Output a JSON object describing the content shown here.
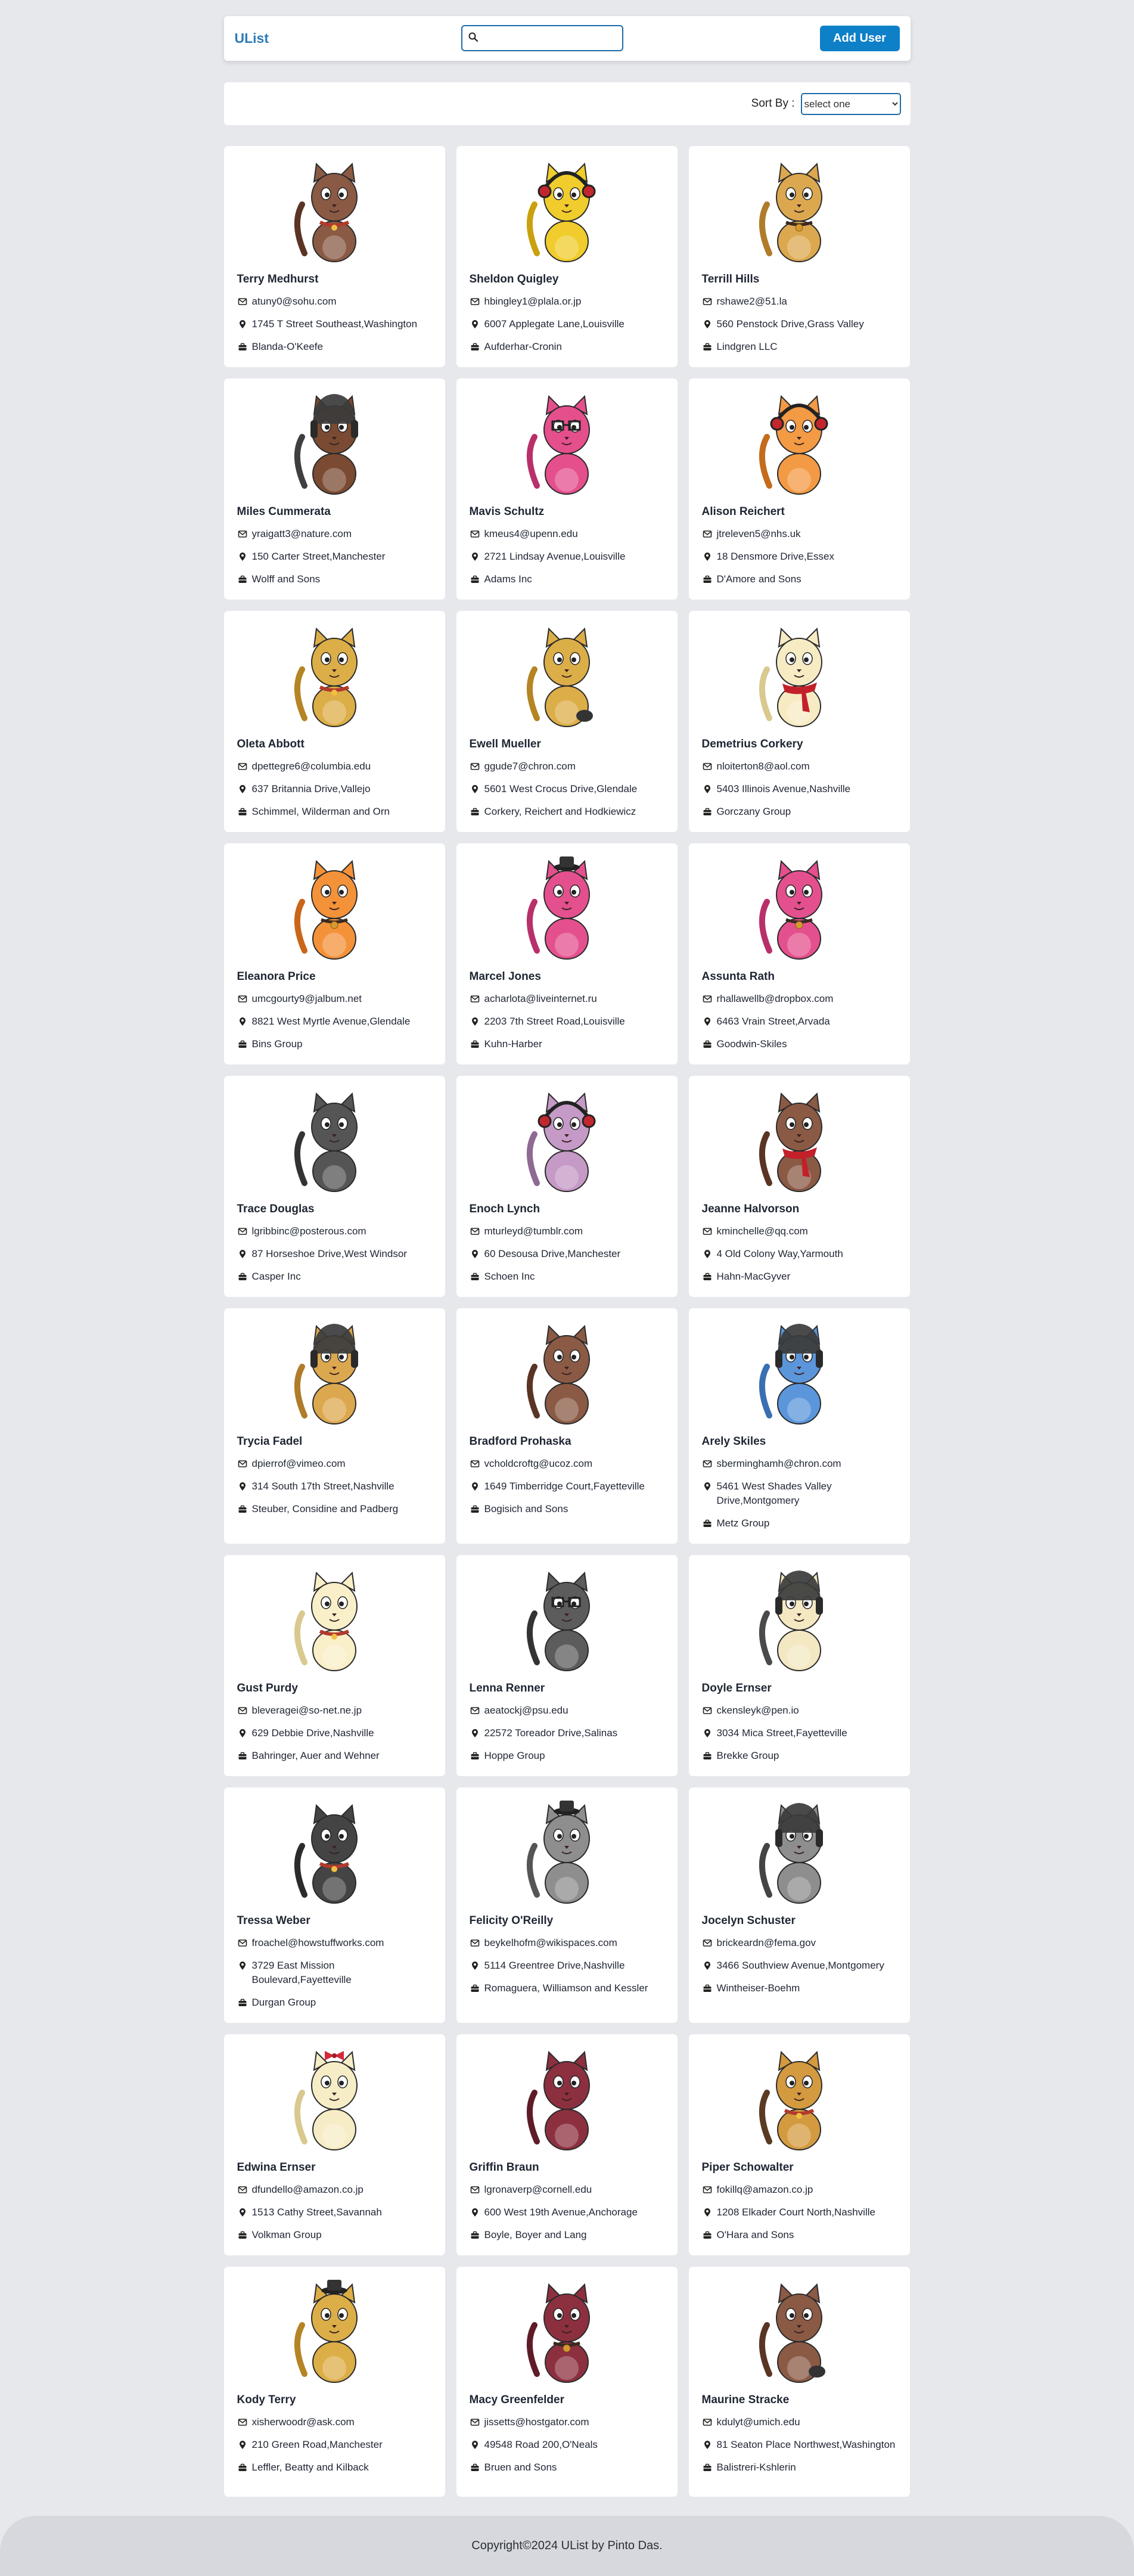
{
  "navbar": {
    "brand": "UList",
    "search_placeholder": "",
    "search_icon": "search-icon",
    "add_label": "Add User"
  },
  "sort": {
    "label": "Sort By :",
    "selected": "select one"
  },
  "users": [
    {
      "name": "Terry Medhurst",
      "email": "atuny0@sohu.com",
      "address": "1745 T Street Southeast,Washington",
      "company": "Blanda-O'Keefe",
      "body": "#8a5a45",
      "accent": "#5a3424",
      "acc": "collar"
    },
    {
      "name": "Sheldon Quigley",
      "email": "hbingley1@plala.or.jp",
      "address": "6007 Applegate Lane,Louisville",
      "company": "Aufderhar-Cronin",
      "body": "#f0cd2c",
      "accent": "#c9a10e",
      "acc": "headphones"
    },
    {
      "name": "Terrill Hills",
      "email": "rshawe2@51.la",
      "address": "560 Penstock Drive,Grass Valley",
      "company": "Lindgren LLC",
      "body": "#dca84f",
      "accent": "#b07c2a",
      "acc": "bell"
    },
    {
      "name": "Miles Cummerata",
      "email": "yraigatt3@nature.com",
      "address": "150 Carter Street,Manchester",
      "company": "Wolff and Sons",
      "body": "#7a4a32",
      "accent": "#3f3f3f",
      "acc": "helmet"
    },
    {
      "name": "Mavis Schultz",
      "email": "kmeus4@upenn.edu",
      "address": "2721 Lindsay Avenue,Louisville",
      "company": "Adams Inc",
      "body": "#e44f8c",
      "accent": "#b8306a",
      "acc": "glasses"
    },
    {
      "name": "Alison Reichert",
      "email": "jtreleven5@nhs.uk",
      "address": "18 Densmore Drive,Essex",
      "company": "D'Amore and Sons",
      "body": "#f39a44",
      "accent": "#c46b1c",
      "acc": "headphones"
    },
    {
      "name": "Oleta Abbott",
      "email": "dpettegre6@columbia.edu",
      "address": "637 Britannia Drive,Vallejo",
      "company": "Schimmel, Wilderman and Orn",
      "body": "#dcae48",
      "accent": "#b58424",
      "acc": "collar"
    },
    {
      "name": "Ewell Mueller",
      "email": "ggude7@chron.com",
      "address": "5601 West Crocus Drive,Glendale",
      "company": "Corkery, Reichert and Hodkiewicz",
      "body": "#dcae48",
      "accent": "#b58424",
      "acc": "paw"
    },
    {
      "name": "Demetrius Corkery",
      "email": "nloiterton8@aol.com",
      "address": "5403 Illinois Avenue,Nashville",
      "company": "Gorczany Group",
      "body": "#f7ebc4",
      "accent": "#d9c98f",
      "acc": "scarf"
    },
    {
      "name": "Eleanora Price",
      "email": "umcgourty9@jalbum.net",
      "address": "8821 West Myrtle Avenue,Glendale",
      "company": "Bins Group",
      "body": "#f4923a",
      "accent": "#c9661a",
      "acc": "bell"
    },
    {
      "name": "Marcel Jones",
      "email": "acharlota@liveinternet.ru",
      "address": "2203 7th Street Road,Louisville",
      "company": "Kuhn-Harber",
      "body": "#e4508d",
      "accent": "#b8306a",
      "acc": "hat"
    },
    {
      "name": "Assunta Rath",
      "email": "rhallawellb@dropbox.com",
      "address": "6463 Vrain Street,Arvada",
      "company": "Goodwin-Skiles",
      "body": "#e4508d",
      "accent": "#b8306a",
      "acc": "bell"
    },
    {
      "name": "Trace Douglas",
      "email": "lgribbinc@posterous.com",
      "address": "87 Horseshoe Drive,West Windsor",
      "company": "Casper Inc",
      "body": "#555555",
      "accent": "#333333",
      "acc": "none"
    },
    {
      "name": "Enoch Lynch",
      "email": "mturleyd@tumblr.com",
      "address": "60 Desousa Drive,Manchester",
      "company": "Schoen Inc",
      "body": "#c59ac6",
      "accent": "#8f6a92",
      "acc": "headphones"
    },
    {
      "name": "Jeanne Halvorson",
      "email": "kminchelle@qq.com",
      "address": "4 Old Colony Way,Yarmouth",
      "company": "Hahn-MacGyver",
      "body": "#8a5a45",
      "accent": "#5a3424",
      "acc": "scarf"
    },
    {
      "name": "Trycia Fadel",
      "email": "dpierrof@vimeo.com",
      "address": "314 South 17th Street,Nashville",
      "company": "Steuber, Considine and Padberg",
      "body": "#dca84f",
      "accent": "#b07c2a",
      "acc": "helmet"
    },
    {
      "name": "Bradford Prohaska",
      "email": "vcholdcroftg@ucoz.com",
      "address": "1649 Timberridge Court,Fayetteville",
      "company": "Bogisich and Sons",
      "body": "#8a5a45",
      "accent": "#5a3424",
      "acc": "none"
    },
    {
      "name": "Arely Skiles",
      "email": "sberminghamh@chron.com",
      "address": "5461 West Shades Valley Drive,Montgomery",
      "company": "Metz Group",
      "body": "#5b96db",
      "accent": "#3a6fb2",
      "acc": "helmet"
    },
    {
      "name": "Gust Purdy",
      "email": "bleveragei@so-net.ne.jp",
      "address": "629 Debbie Drive,Nashville",
      "company": "Bahringer, Auer and Wehner",
      "body": "#f9efc8",
      "accent": "#d9c98f",
      "acc": "collar"
    },
    {
      "name": "Lenna Renner",
      "email": "aeatockj@psu.edu",
      "address": "22572 Toreador Drive,Salinas",
      "company": "Hoppe Group",
      "body": "#5c5c5c",
      "accent": "#333333",
      "acc": "glasses"
    },
    {
      "name": "Doyle Ernser",
      "email": "ckensleyk@pen.io",
      "address": "3034 Mica Street,Fayetteville",
      "company": "Brekke Group",
      "body": "#f3e8c2",
      "accent": "#4a4a4a",
      "acc": "helmet"
    },
    {
      "name": "Tressa Weber",
      "email": "froachel@howstuffworks.com",
      "address": "3729 East Mission Boulevard,Fayetteville",
      "company": "Durgan Group",
      "body": "#444444",
      "accent": "#2b2b2b",
      "acc": "collar"
    },
    {
      "name": "Felicity O'Reilly",
      "email": "beykelhofm@wikispaces.com",
      "address": "5114 Greentree Drive,Nashville",
      "company": "Romaguera, Williamson and Kessler",
      "body": "#8e8e8e",
      "accent": "#555555",
      "acc": "hat"
    },
    {
      "name": "Jocelyn Schuster",
      "email": "brickeardn@fema.gov",
      "address": "3466 Southview Avenue,Montgomery",
      "company": "Wintheiser-Boehm",
      "body": "#8e8e8e",
      "accent": "#444444",
      "acc": "helmet"
    },
    {
      "name": "Edwina Ernser",
      "email": "dfundello@amazon.co.jp",
      "address": "1513 Cathy Street,Savannah",
      "company": "Volkman Group",
      "body": "#f6ecc6",
      "accent": "#d9c98f",
      "acc": "bow"
    },
    {
      "name": "Griffin Braun",
      "email": "lgronaverp@cornell.edu",
      "address": "600 West 19th Avenue,Anchorage",
      "company": "Boyle, Boyer and Lang",
      "body": "#8c3040",
      "accent": "#5e1c28",
      "acc": "none"
    },
    {
      "name": "Piper Schowalter",
      "email": "fokillq@amazon.co.jp",
      "address": "1208 Elkader Court North,Nashville",
      "company": "O'Hara and Sons",
      "body": "#d49a40",
      "accent": "#5a3a22",
      "acc": "collar"
    },
    {
      "name": "Kody Terry",
      "email": "xisherwoodr@ask.com",
      "address": "210 Green Road,Manchester",
      "company": "Leffler, Beatty and Kilback",
      "body": "#dcae48",
      "accent": "#b58424",
      "acc": "hat"
    },
    {
      "name": "Macy Greenfelder",
      "email": "jissetts@hostgator.com",
      "address": "49548 Road 200,O'Neals",
      "company": "Bruen and Sons",
      "body": "#8c3040",
      "accent": "#5e1c28",
      "acc": "bell"
    },
    {
      "name": "Maurine Stracke",
      "email": "kdulyt@umich.edu",
      "address": "81 Seaton Place Northwest,Washington",
      "company": "Balistreri-Kshlerin",
      "body": "#8a5a45",
      "accent": "#5a3424",
      "acc": "paw"
    }
  ],
  "icons": {
    "email": "envelope-icon",
    "address": "map-pin-icon",
    "company": "briefcase-icon"
  },
  "footer": {
    "text": "Copyright©2024 UList by Pinto Das."
  }
}
